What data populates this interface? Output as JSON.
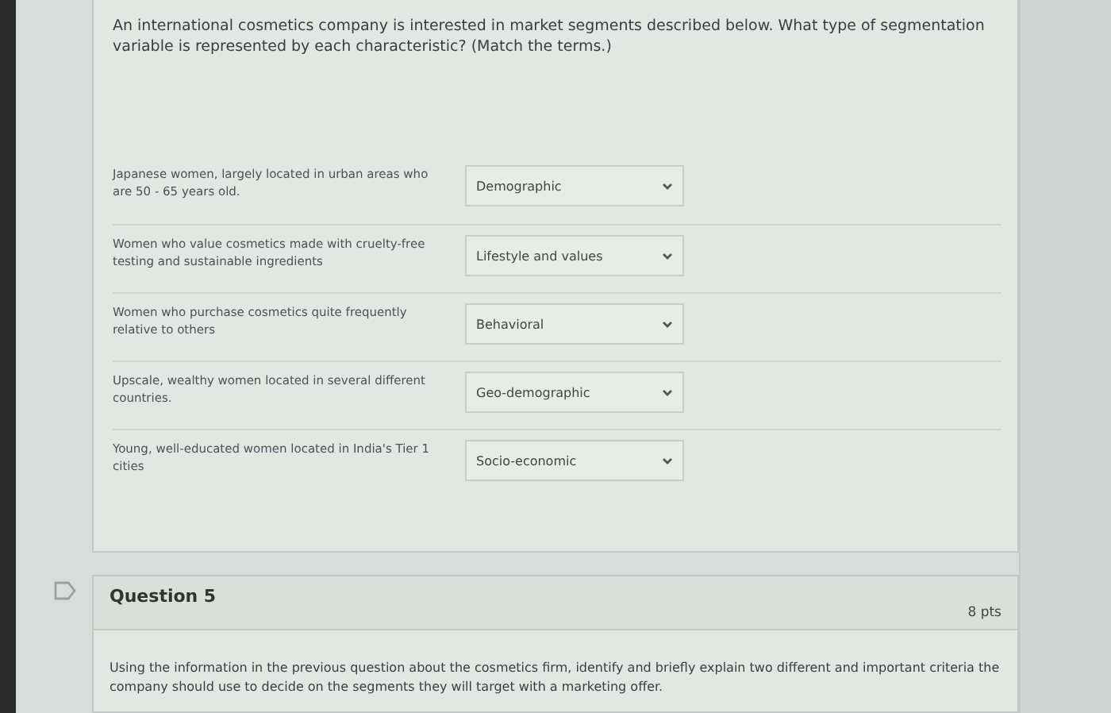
{
  "question_4": {
    "prompt": "An international cosmetics company is interested in market segments described below.  What type of segmentation variable is represented by each characteristic?   (Match the terms.)",
    "matches": [
      {
        "statement": "Japanese women, largely located in urban areas who are 50 - 65 years old.",
        "answer": "Demographic"
      },
      {
        "statement": "Women who value cosmetics made with cruelty-free testing and sustainable ingredients",
        "answer": "Lifestyle and values"
      },
      {
        "statement": "Women who purchase cosmetics quite frequently relative to others",
        "answer": "Behavioral"
      },
      {
        "statement": "Upscale, wealthy women located in several different countries.",
        "answer": "Geo-demographic"
      },
      {
        "statement": "Young, well-educated women located in India's Tier 1 cities",
        "answer": "Socio-economic"
      }
    ]
  },
  "question_5": {
    "title": "Question 5",
    "points": "8 pts",
    "body": "Using the information in the previous question about the cosmetics firm, identify and briefly explain two different and important criteria the company should use to decide on the segments they will target with a marketing offer."
  }
}
